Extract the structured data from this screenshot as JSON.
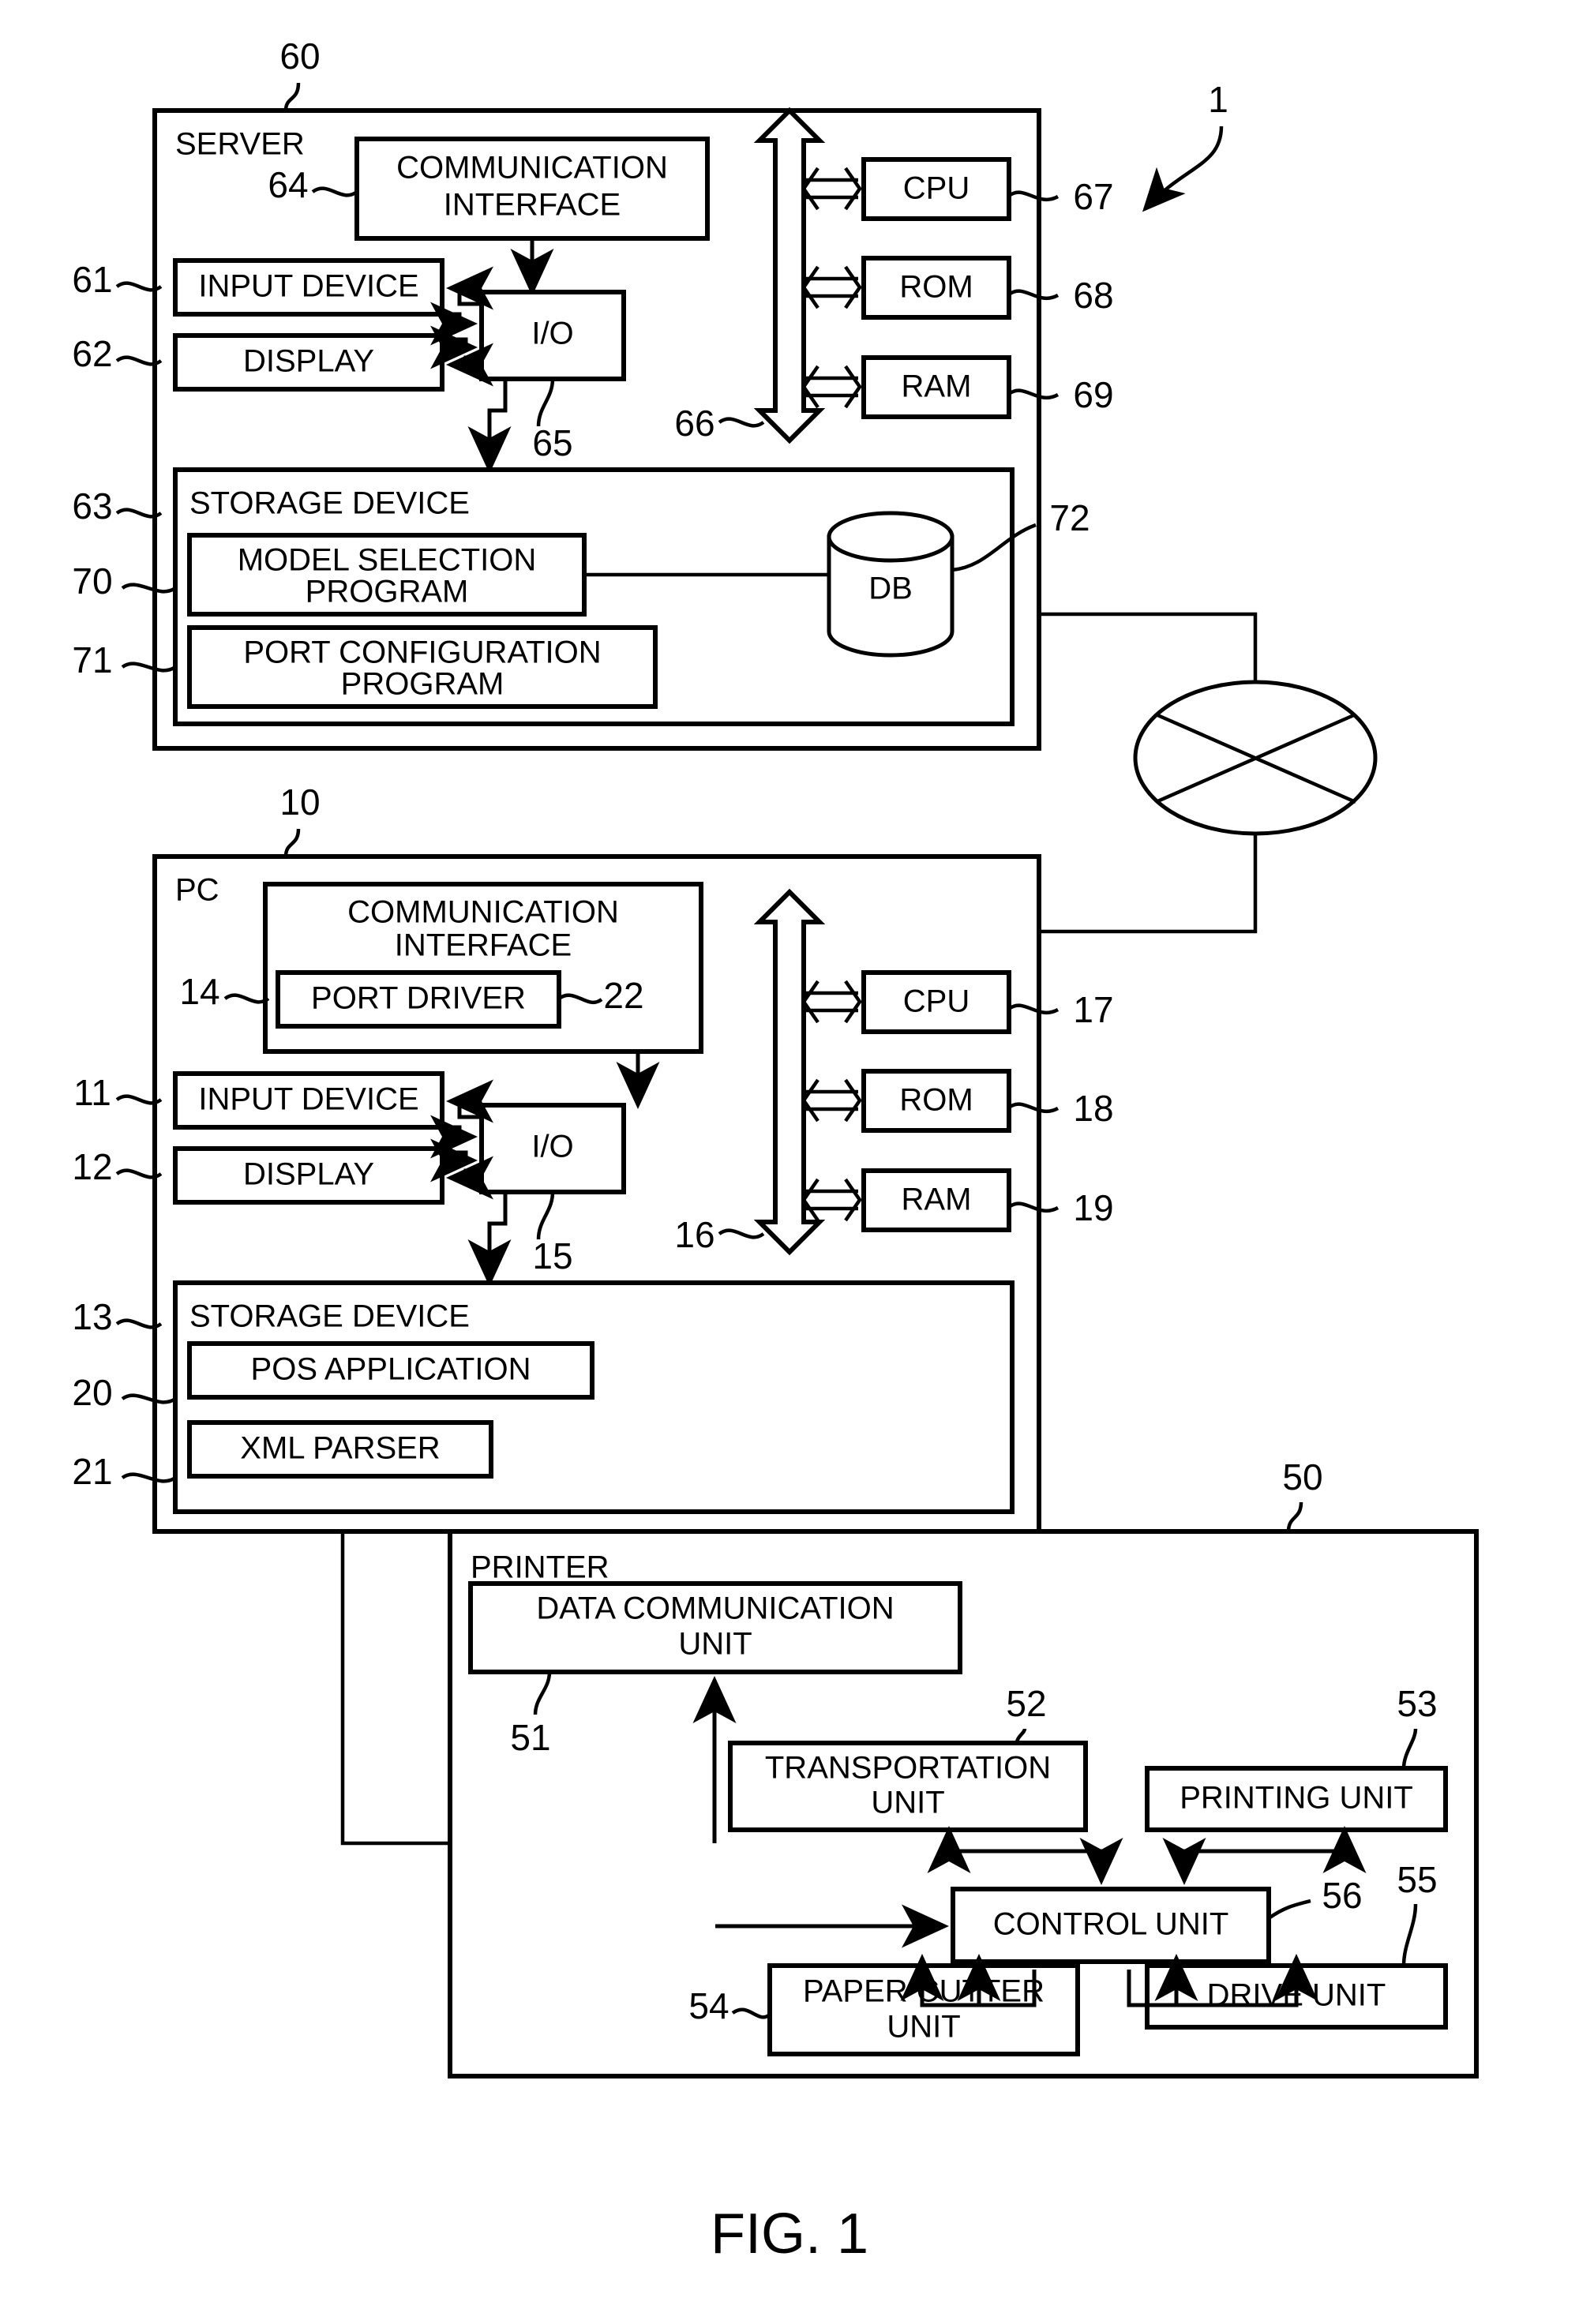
{
  "figure": {
    "caption": "FIG. 1",
    "system_ref": "1"
  },
  "server": {
    "title": "SERVER",
    "ref": "60",
    "blocks": {
      "communication_interface": {
        "label": "COMMUNICATION INTERFACE",
        "line1": "COMMUNICATION",
        "line2": "INTERFACE",
        "ref": "64"
      },
      "input_device": {
        "label": "INPUT DEVICE",
        "ref": "61"
      },
      "display": {
        "label": "DISPLAY",
        "ref": "62"
      },
      "io": {
        "label": "I/O",
        "ref": "65"
      },
      "bus": {
        "ref": "66"
      },
      "cpu": {
        "label": "CPU",
        "ref": "67"
      },
      "rom": {
        "label": "ROM",
        "ref": "68"
      },
      "ram": {
        "label": "RAM",
        "ref": "69"
      },
      "storage_device": {
        "label": "STORAGE DEVICE",
        "ref": "63"
      },
      "model_selection_program": {
        "label": "MODEL SELECTION PROGRAM",
        "line1": "MODEL SELECTION",
        "line2": "PROGRAM",
        "ref": "70"
      },
      "port_configuration_program": {
        "label": "PORT CONFIGURATION PROGRAM",
        "line1": "PORT CONFIGURATION",
        "line2": "PROGRAM",
        "ref": "71"
      },
      "db": {
        "label": "DB",
        "ref": "72"
      }
    }
  },
  "network": {
    "symbol": "network-cloud-icon"
  },
  "pc": {
    "title": "PC",
    "ref": "10",
    "blocks": {
      "communication_interface": {
        "label": "COMMUNICATION INTERFACE",
        "line1": "COMMUNICATION",
        "line2": "INTERFACE",
        "ref": "14"
      },
      "port_driver": {
        "label": "PORT DRIVER",
        "ref": "22"
      },
      "input_device": {
        "label": "INPUT DEVICE",
        "ref": "11"
      },
      "display": {
        "label": "DISPLAY",
        "ref": "12"
      },
      "io": {
        "label": "I/O",
        "ref": "15"
      },
      "bus": {
        "ref": "16"
      },
      "cpu": {
        "label": "CPU",
        "ref": "17"
      },
      "rom": {
        "label": "ROM",
        "ref": "18"
      },
      "ram": {
        "label": "RAM",
        "ref": "19"
      },
      "storage_device": {
        "label": "STORAGE DEVICE",
        "ref": "13"
      },
      "pos_application": {
        "label": "POS APPLICATION",
        "ref": "20"
      },
      "xml_parser": {
        "label": "XML PARSER",
        "ref": "21"
      }
    }
  },
  "printer": {
    "title": "PRINTER",
    "ref": "50",
    "blocks": {
      "data_communication_unit": {
        "label": "DATA COMMUNICATION UNIT",
        "line1": "DATA COMMUNICATION",
        "line2": "UNIT",
        "ref": "51"
      },
      "transportation_unit": {
        "label": "TRANSPORTATION UNIT",
        "line1": "TRANSPORTATION",
        "line2": "UNIT",
        "ref": "52"
      },
      "printing_unit": {
        "label": "PRINTING UNIT",
        "ref": "53"
      },
      "control_unit": {
        "label": "CONTROL UNIT",
        "ref": "56"
      },
      "paper_cutter_unit": {
        "label": "PAPER CUTTER UNIT",
        "line1": "PAPER CUTTER",
        "line2": "UNIT",
        "ref": "54"
      },
      "drive_unit": {
        "label": "DRIVE UNIT",
        "ref": "55"
      }
    }
  }
}
